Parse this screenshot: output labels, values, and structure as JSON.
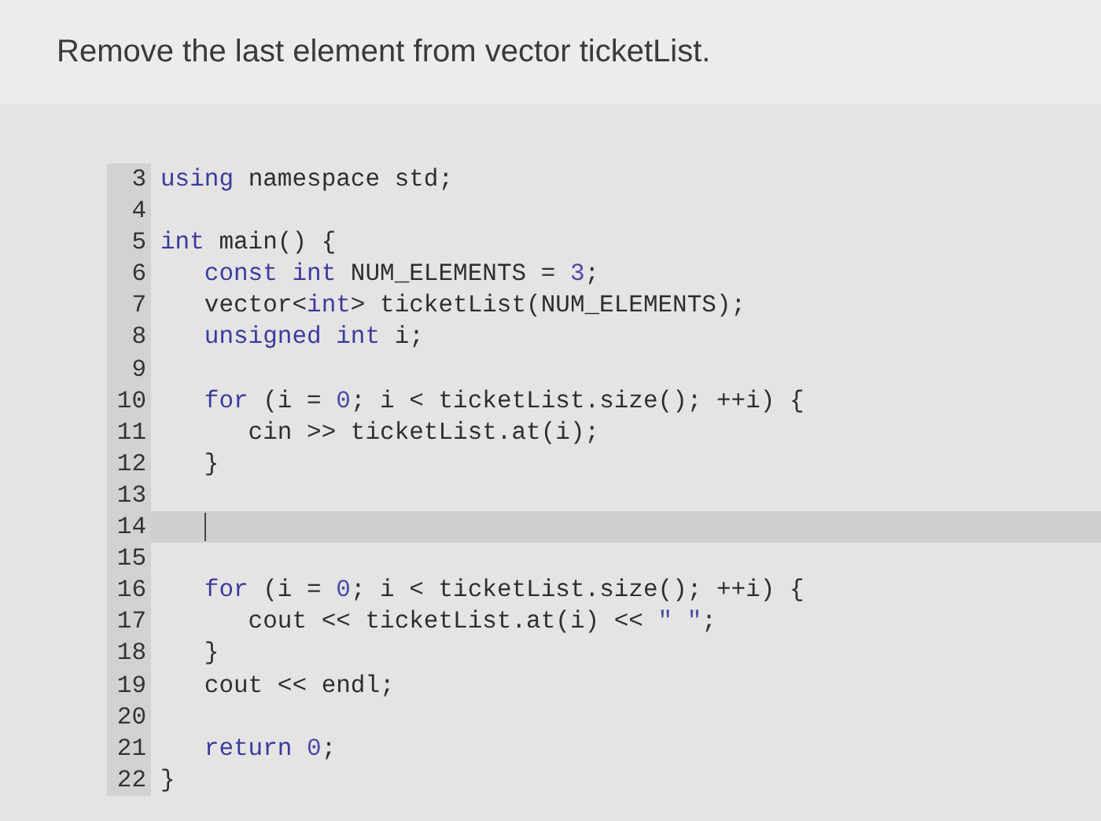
{
  "title": "Remove the last element from vector ticketList.",
  "code_lines": [
    {
      "number": "3",
      "active": false,
      "tokens": [
        {
          "text": "using",
          "kind": "keyword"
        },
        {
          "text": " namespace std;",
          "kind": "plain"
        }
      ]
    },
    {
      "number": "4",
      "active": false
    },
    {
      "number": "5",
      "active": false,
      "tokens": [
        {
          "text": "int",
          "kind": "keyword"
        },
        {
          "text": " main() {",
          "kind": "plain"
        }
      ]
    },
    {
      "number": "6",
      "active": false,
      "tokens": [
        {
          "text": "   const int",
          "kind": "keyword"
        },
        {
          "text": " NUM_ELEMENTS = ",
          "kind": "plain"
        },
        {
          "text": "3",
          "kind": "literal"
        },
        {
          "text": ";",
          "kind": "plain"
        }
      ]
    },
    {
      "number": "7",
      "active": false,
      "tokens": [
        {
          "text": "   vector<",
          "kind": "plain"
        },
        {
          "text": "int",
          "kind": "keyword"
        },
        {
          "text": "> ticketList(NUM_ELEMENTS);",
          "kind": "plain"
        }
      ]
    },
    {
      "number": "8",
      "active": false,
      "tokens": [
        {
          "text": "   unsigned int",
          "kind": "keyword"
        },
        {
          "text": " i;",
          "kind": "plain"
        }
      ]
    },
    {
      "number": "9",
      "active": false
    },
    {
      "number": "10",
      "active": false,
      "tokens": [
        {
          "text": "   for",
          "kind": "keyword"
        },
        {
          "text": " (i = ",
          "kind": "plain"
        },
        {
          "text": "0",
          "kind": "literal"
        },
        {
          "text": "; i < ticketList.size(); ++i) {",
          "kind": "plain"
        }
      ]
    },
    {
      "number": "11",
      "active": false,
      "tokens": [
        {
          "text": "      cin >> ticketList.at(i);",
          "kind": "plain"
        }
      ]
    },
    {
      "number": "12",
      "active": false,
      "tokens": [
        {
          "text": "   }",
          "kind": "plain"
        }
      ]
    },
    {
      "number": "13",
      "active": false
    },
    {
      "number": "14",
      "active": true
    },
    {
      "number": "15",
      "active": false
    },
    {
      "number": "16",
      "active": false,
      "tokens": [
        {
          "text": "   for",
          "kind": "keyword"
        },
        {
          "text": " (i = ",
          "kind": "plain"
        },
        {
          "text": "0",
          "kind": "literal"
        },
        {
          "text": "; i < ticketList.size(); ++i) {",
          "kind": "plain"
        }
      ]
    },
    {
      "number": "17",
      "active": false,
      "tokens": [
        {
          "text": "      cout << ticketList.at(i) << ",
          "kind": "plain"
        },
        {
          "text": "\" \"",
          "kind": "literal"
        },
        {
          "text": ";",
          "kind": "plain"
        }
      ]
    },
    {
      "number": "18",
      "active": false,
      "tokens": [
        {
          "text": "   }",
          "kind": "plain"
        }
      ]
    },
    {
      "number": "19",
      "active": false,
      "tokens": [
        {
          "text": "   cout << endl;",
          "kind": "plain"
        }
      ]
    },
    {
      "number": "20",
      "active": false
    },
    {
      "number": "21",
      "active": false,
      "tokens": [
        {
          "text": "   return",
          "kind": "keyword"
        },
        {
          "text": " 0",
          "kind": "literal"
        },
        {
          "text": ";",
          "kind": "plain"
        }
      ]
    },
    {
      "number": "22",
      "active": false,
      "tokens": [
        {
          "text": "}",
          "kind": "plain"
        }
      ]
    }
  ]
}
